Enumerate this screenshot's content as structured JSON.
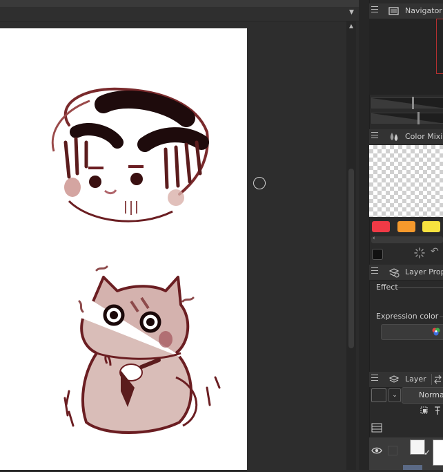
{
  "panels": {
    "navigator": {
      "title": "Navigator"
    },
    "color_mixing": {
      "title": "Color Mixin",
      "swatches": [
        "#f03a46",
        "#f5992c",
        "#f7e23f"
      ],
      "current_color": "#111111"
    },
    "layer_property": {
      "title": "Layer Prope",
      "effect_label": "Effect",
      "expression_color_label": "Expression color"
    },
    "layer": {
      "title": "Layer",
      "blend_mode": "Norma"
    }
  },
  "icons": {
    "panel_menu": "hamburger-menu-icon",
    "navigator": "navigator-icon",
    "color_mixing": "color-mixing-drops-icon",
    "layer_property": "layer-property-icon",
    "layer": "layers-stack-icon",
    "visibility": "eye-icon"
  },
  "colors": {
    "ink": "#6b1e22",
    "paper": "#ffffff",
    "panel_bg": "#2a2a2a"
  }
}
